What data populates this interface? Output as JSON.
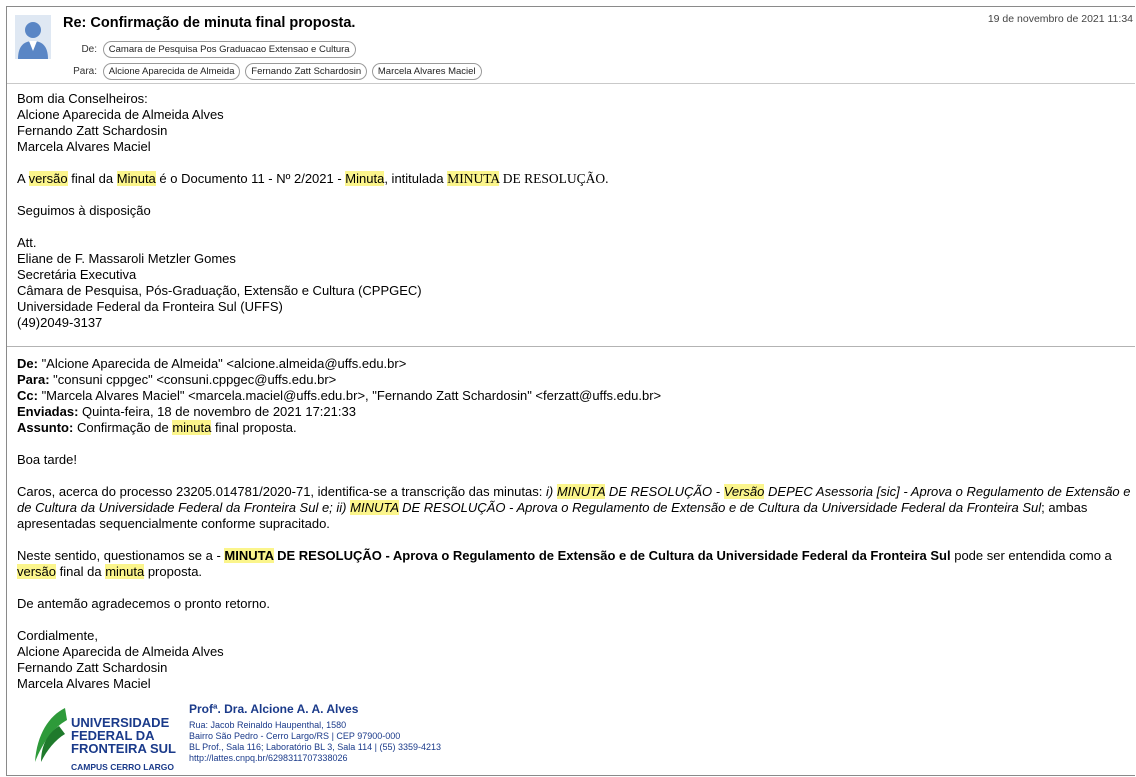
{
  "header": {
    "subject": "Re: Confirmação de minuta final proposta.",
    "date": "19 de novembro de 2021 11:34",
    "from_label": "De:",
    "from": [
      "Camara de Pesquisa Pos Graduacao Extensao e Cultura"
    ],
    "to_label": "Para:",
    "to": [
      "Alcione Aparecida de Almeida",
      "Fernando Zatt Schardosin",
      "Marcela Alvares Maciel"
    ]
  },
  "body": {
    "greeting": "Bom dia Conselheiros:",
    "names": [
      "Alcione Aparecida de Almeida Alves",
      "Fernando Zatt Schardosin",
      "Marcela Alvares Maciel"
    ],
    "p1_a": "A ",
    "p1_hl1": "versão",
    "p1_b": " final da ",
    "p1_hl2": "Minuta",
    "p1_c": " é o Documento 11 - Nº 2/2021 - ",
    "p1_hl3": "Minuta",
    "p1_d": ", intitulada ",
    "p1_hl4": "MINUTA",
    "p1_e": " DE RESOLUÇÃO.",
    "p2": "Seguimos à disposição",
    "signature": [
      "Att.",
      "Eliane de F. Massaroli Metzler Gomes",
      "Secretária Executiva",
      "Câmara de Pesquisa, Pós-Graduação, Extensão e Cultura (CPPGEC)",
      "Universidade Federal da Fronteira Sul (UFFS)",
      "(49)2049-3137"
    ]
  },
  "quoted": {
    "de_label": "De:",
    "de": " \"Alcione Aparecida de Almeida\" <alcione.almeida@uffs.edu.br>",
    "para_label": "Para:",
    "para": " \"consuni cppgec\" <consuni.cppgec@uffs.edu.br>",
    "cc_label": "Cc:",
    "cc": " \"Marcela Alvares Maciel\" <marcela.maciel@uffs.edu.br>, \"Fernando Zatt Schardosin\" <ferzatt@uffs.edu.br>",
    "enviadas_label": "Enviadas:",
    "enviadas": " Quinta-feira, 18 de novembro de 2021 17:21:33",
    "assunto_label": "Assunto:",
    "assunto_a": " Confirmação de ",
    "assunto_hl": "minuta",
    "assunto_b": " final proposta.",
    "greeting": "Boa tarde!",
    "c1": "Caros, acerca do processo 23205.014781/2020-71, identifica-se a transcrição das minutas: ",
    "c2": "i) ",
    "c3": "MINUTA",
    "c4": " DE RESOLUÇÃO - ",
    "c5": "Versão",
    "c6": " DEPEC Asessoria [sic] - Aprova o Regulamento de Extensão e de Cultura da Universidade Federal da Fronteira Sul e; ii) ",
    "c7": "MINUTA",
    "c8": " DE RESOLUÇÃO - Aprova o Regulamento de Extensão e de Cultura da Universidade Federal da Fronteira Sul",
    "c9": "; ambas apresentadas sequencialmente conforme supracitado.",
    "n1": "Neste sentido, questionamos se a - ",
    "n2": "MINUTA",
    "n3": " DE RESOLUÇÃO - Aprova o Regulamento de Extensão e de Cultura da Universidade Federal da Fronteira Sul",
    "n4": " pode ser entendida como a ",
    "n5": "versão",
    "n6": " final da ",
    "n7": "minuta",
    "n8": " proposta.",
    "thanks": "De antemão agradecemos o pronto retorno.",
    "closing": "Cordialmente,",
    "names": [
      "Alcione Aparecida de Almeida Alves",
      "Fernando Zatt Schardosin",
      "Marcela Alvares Maciel"
    ]
  },
  "sigblock": {
    "uni_lines": [
      "UNIVERSIDADE",
      "FEDERAL DA",
      "FRONTEIRA SUL"
    ],
    "campus": "CAMPUS CERRO LARGO",
    "prof": "Profª. Dra. Alcione A. A. Alves",
    "lines": [
      "Rua: Jacob Reinaldo Haupenthal, 1580",
      "Bairro São Pedro - Cerro Largo/RS | CEP 97900-000",
      "BL Prof., Sala 116; Laboratório BL 3, Sala 114 | (55) 3359-4213",
      "http://lattes.cnpq.br/6298311707338026"
    ]
  },
  "colors": {
    "highlight": "#fbf58c",
    "logo_green": "#2e9a3a",
    "logo_blue": "#1a3a8a"
  }
}
